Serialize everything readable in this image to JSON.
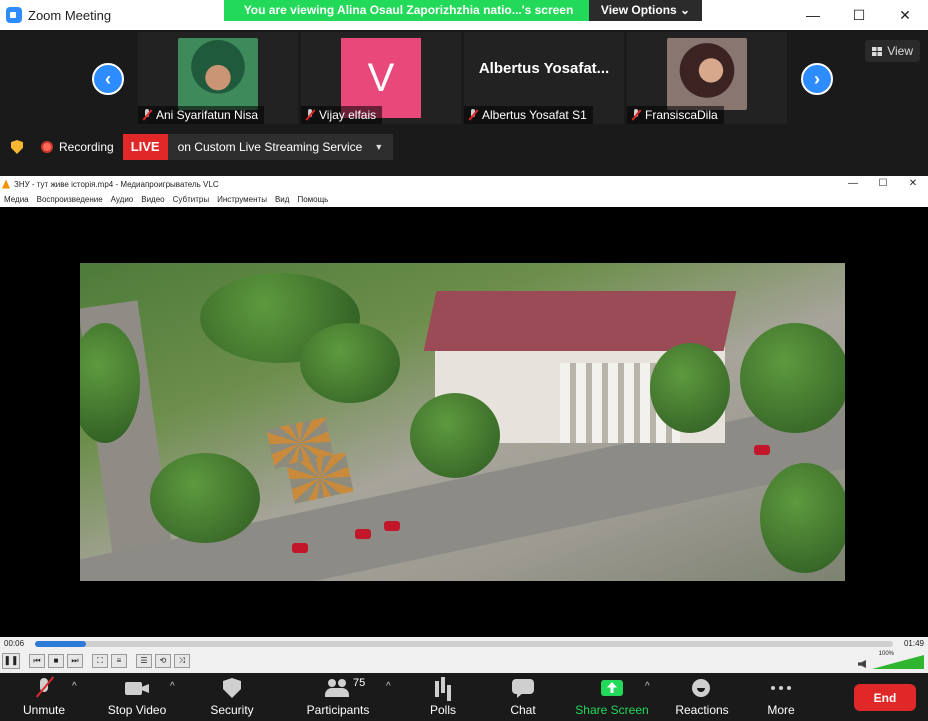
{
  "window": {
    "title": "Zoom Meeting",
    "controls": [
      "—",
      "☐",
      "✕"
    ]
  },
  "share_banner": {
    "text": "You are viewing Alina Osaul Zaporizhzhia natio...'s screen",
    "options_label": "View Options ⌄"
  },
  "gallery": {
    "view_label": "View",
    "participants": [
      {
        "name": "Ani Syarifatun Nisa",
        "kind": "photo"
      },
      {
        "name": "Vijay elfais",
        "kind": "avatar",
        "initial": "V",
        "color": "#e8487a"
      },
      {
        "name": "Albertus Yosafat S1",
        "kind": "name-only",
        "display": "Albertus  Yosafat..."
      },
      {
        "name": "FransiscaDila",
        "kind": "photo"
      }
    ]
  },
  "recording": {
    "label": "Recording",
    "live_label": "LIVE",
    "service": "on Custom Live Streaming Service"
  },
  "vlc": {
    "title": "ЗНУ - тут живе історія.mp4 - Медиапроигрыватель VLC",
    "menu": [
      "Медиа",
      "Воспроизведение",
      "Аудио",
      "Видео",
      "Субтитры",
      "Инструменты",
      "Вид",
      "Помощь"
    ],
    "time_elapsed": "00:06",
    "time_total": "01:49",
    "progress": 0.06,
    "volume_label": "100%",
    "volume": 1.0
  },
  "toolbar": {
    "items": [
      {
        "label": "Unmute",
        "icon": "microphone-muted-icon"
      },
      {
        "label": "Stop Video",
        "icon": "video-camera-icon"
      },
      {
        "label": "Security",
        "icon": "shield-icon"
      },
      {
        "label": "Participants",
        "icon": "participants-icon",
        "count": "75"
      },
      {
        "label": "Polls",
        "icon": "polls-icon"
      },
      {
        "label": "Chat",
        "icon": "chat-icon"
      },
      {
        "label": "Share Screen",
        "icon": "share-screen-icon"
      },
      {
        "label": "Reactions",
        "icon": "reactions-icon"
      },
      {
        "label": "More",
        "icon": "more-icon"
      }
    ],
    "end_label": "End"
  },
  "colors": {
    "share_green": "#23d959",
    "zoom_blue": "#2d8cff",
    "live_red": "#e02828"
  }
}
